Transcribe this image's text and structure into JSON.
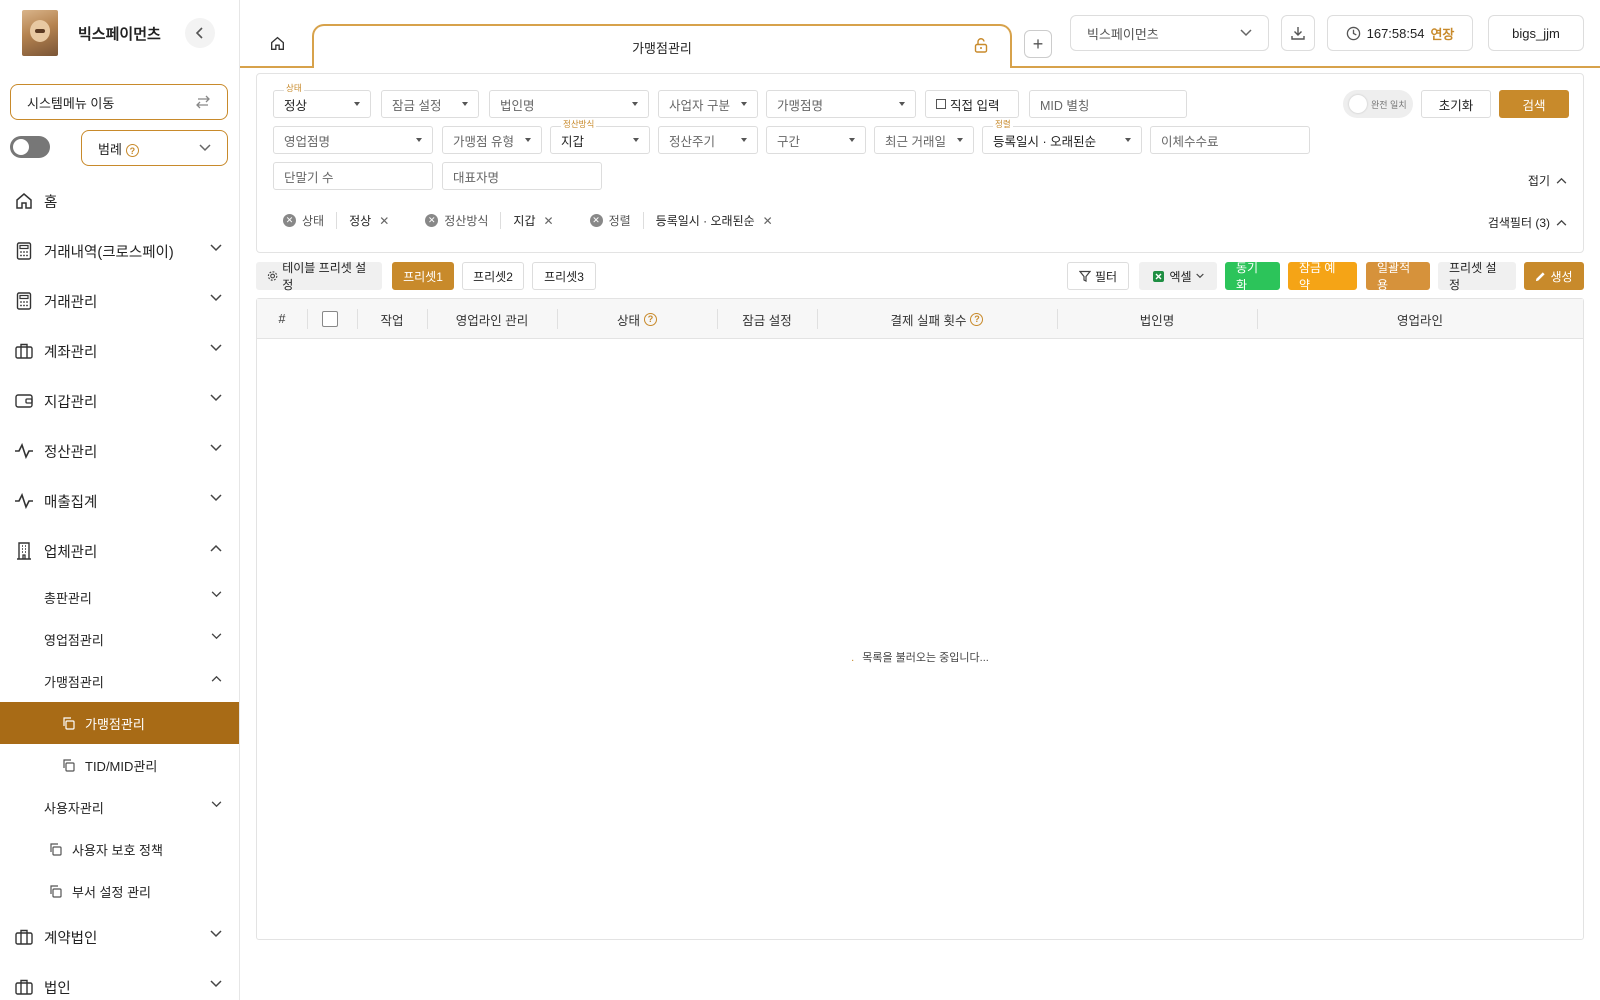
{
  "sidebar": {
    "brand": "빅스페이먼츠",
    "system_menu": "시스템메뉴 이동",
    "legend": "범례",
    "nav": [
      {
        "label": "홈"
      },
      {
        "label": "거래내역(크로스페이)"
      },
      {
        "label": "거래관리"
      },
      {
        "label": "계좌관리"
      },
      {
        "label": "지갑관리"
      },
      {
        "label": "정산관리"
      },
      {
        "label": "매출집계"
      },
      {
        "label": "업체관리"
      }
    ],
    "sub": {
      "dist": "총판관리",
      "sales": "영업점관리",
      "merchant": "가맹점관리",
      "merchant_leaf": "가맹점관리",
      "tid_leaf": "TID/MID관리",
      "users": "사용자관리",
      "user_policy": "사용자 보호 정책",
      "dept": "부서 설정 관리"
    },
    "bottom_nav": [
      {
        "label": "계약법인"
      },
      {
        "label": "법인"
      }
    ]
  },
  "topbar": {
    "tab_title": "가맹점관리",
    "company": "빅스페이먼츠",
    "timer": "167:58:54",
    "extend": "연장",
    "user": "bigs_jjm"
  },
  "filters": {
    "status_label": "상태",
    "status_value": "정상",
    "lock": "잠금 설정",
    "corp": "법인명",
    "biz_type": "사업자 구분",
    "merchant": "가맹점명",
    "direct_input": "직접 입력",
    "mid_alias": "MID 별칭",
    "exact": "완전 일치",
    "reset": "초기화",
    "search": "검색",
    "sales_office": "영업점명",
    "merchant_type": "가맹점 유형",
    "settle_label": "정산방식",
    "settle_value": "지갑",
    "settle_cycle": "정산주기",
    "range": "구간",
    "recent": "최근 거래일",
    "sort_label": "정렬",
    "sort_value": "등록일시 · 오래된순",
    "transfer_fee": "이체수수료",
    "terminals": "단말기 수",
    "ceo": "대표자명",
    "collapse": "접기",
    "chips": [
      {
        "key": "상태",
        "value": "정상"
      },
      {
        "key": "정산방식",
        "value": "지갑"
      },
      {
        "key": "정렬",
        "value": "등록일시 · 오래된순"
      }
    ],
    "filter_count": "검색필터 (3)"
  },
  "toolbar": {
    "preset_setting": "테이블 프리셋 설정",
    "preset1": "프리셋1",
    "preset2": "프리셋2",
    "preset3": "프리셋3",
    "filter": "필터",
    "excel": "엑셀",
    "sync": "동기화",
    "lock_reserve": "잠금 예약",
    "bulk": "일괄적용",
    "preset_config": "프리셋 설정",
    "create": "생성"
  },
  "table": {
    "columns": [
      "#",
      "",
      "작업",
      "영업라인 관리",
      "상태",
      "잠금 설정",
      "결제 실패 횟수",
      "법인명",
      "영업라인"
    ],
    "loading": "목록을 불러오는 중입니다..."
  },
  "colors": {
    "accent": "#c88a2b",
    "active_bg": "#a86b16",
    "sync": "#2cc45a",
    "lock_reserve": "#f5a416"
  }
}
